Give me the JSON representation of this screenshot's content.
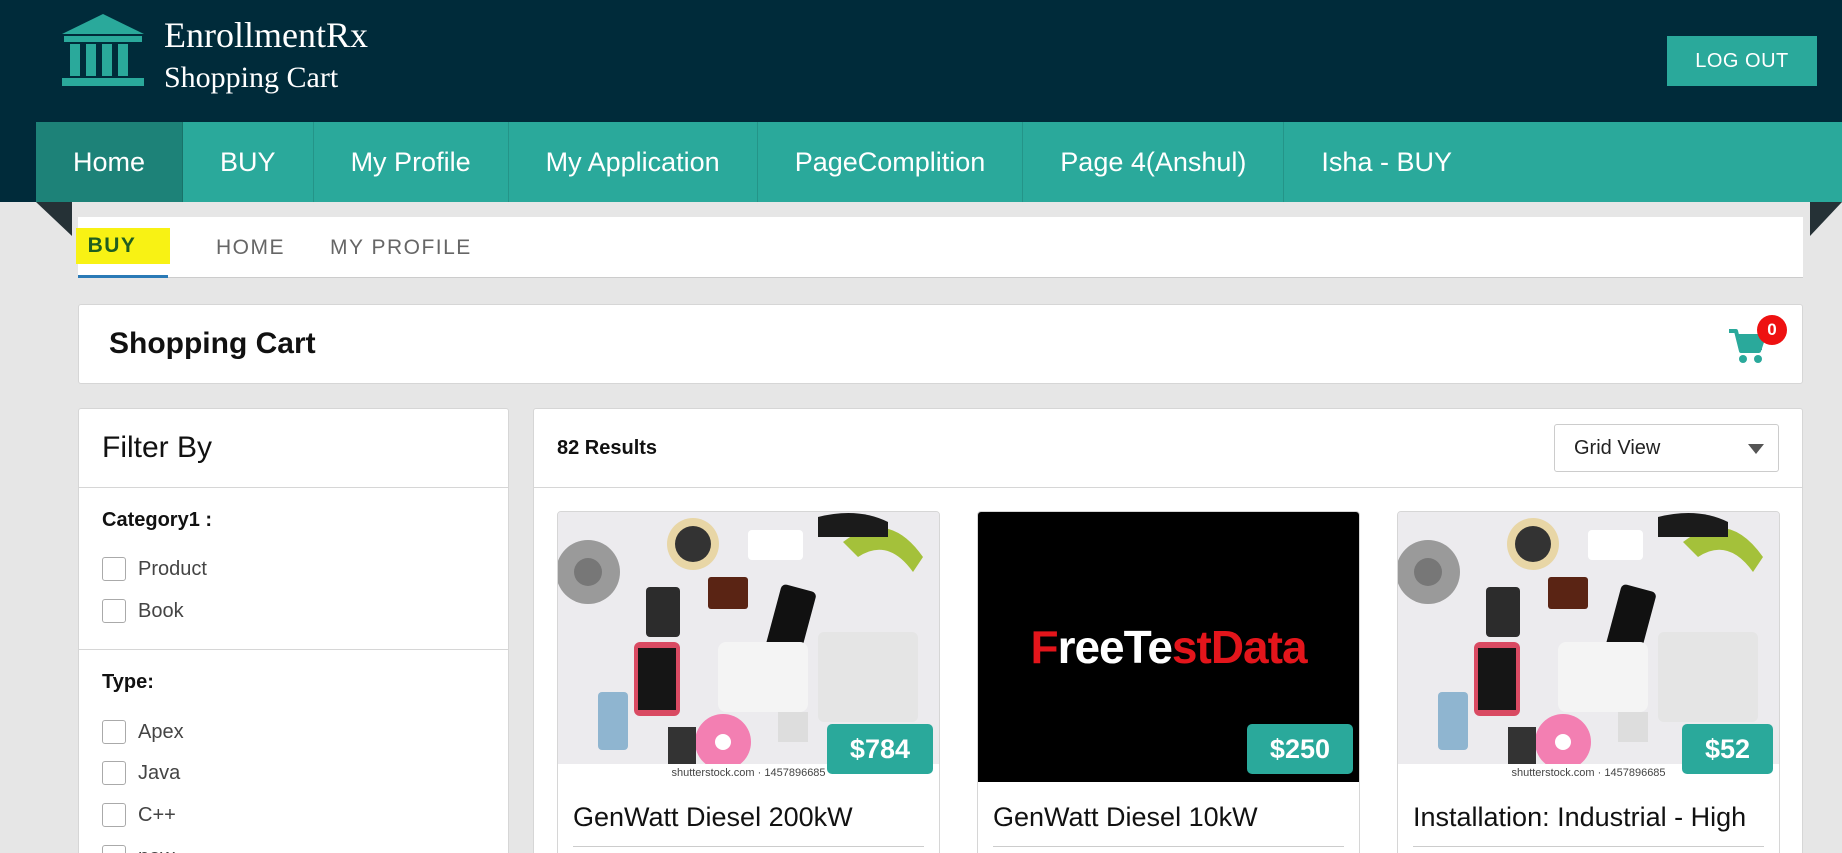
{
  "header": {
    "brand_name": "EnrollmentRx",
    "brand_sub": "Shopping Cart",
    "logout_label": "LOG OUT"
  },
  "nav": {
    "items": [
      "Home",
      "BUY",
      "My Profile",
      "My Application",
      "PageComplition",
      "Page 4(Anshul)",
      "Isha - BUY"
    ],
    "active": "Home"
  },
  "subtabs": {
    "items": [
      "BUY",
      "HOME",
      "MY PROFILE"
    ],
    "active": "BUY"
  },
  "cart": {
    "title": "Shopping Cart",
    "count": "0"
  },
  "filter": {
    "title": "Filter By",
    "groups": [
      {
        "label": "Category1 :",
        "options": [
          "Product",
          "Book"
        ]
      },
      {
        "label": "Type:",
        "options": [
          "Apex",
          "Java",
          "C++",
          "new"
        ]
      }
    ]
  },
  "results": {
    "count_label": "82 Results",
    "view": "Grid View",
    "products": [
      {
        "title": "GenWatt Diesel 200kW",
        "price": "$784",
        "image": "electronics-photo",
        "caption": "shutterstock.com · 1457896685"
      },
      {
        "title": "GenWatt Diesel 10kW",
        "price": "$250",
        "image": "freetestdata-logo",
        "logo_parts": [
          "F",
          "ree",
          "Te",
          "st",
          "Data"
        ]
      },
      {
        "title": "Installation: Industrial - High",
        "price": "$52",
        "image": "electronics-photo",
        "caption": "shutterstock.com · 1457896685"
      }
    ]
  },
  "colors": {
    "header_bg": "#002b3a",
    "accent": "#2aa99b",
    "active_nav": "#1d8278",
    "badge": "#ee1111",
    "highlight": "#f8f214"
  }
}
